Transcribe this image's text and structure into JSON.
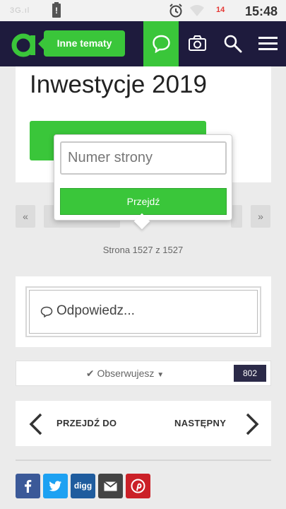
{
  "status_bar": {
    "signal_text": "3G.ıl",
    "battery_alert": "!",
    "badge": "14",
    "time": "15:48",
    "icons": [
      "signal-icon",
      "battery-icon",
      "alarm-icon",
      "wifi-icon"
    ]
  },
  "header": {
    "topics_label": "Inne tematy",
    "icons": [
      "logo-icon",
      "chat-icon",
      "camera-icon",
      "search-icon",
      "menu-icon"
    ],
    "colors": {
      "bar": "#1e1b3d",
      "accent": "#3ac63a"
    }
  },
  "main": {
    "title": "Inwestycje 2019",
    "pager": {
      "first": "«",
      "last": "»"
    },
    "page_info": "Strona 1527 z 1527"
  },
  "popup": {
    "input_placeholder": "Numer strony",
    "input_value": "",
    "go_label": "Przejdź"
  },
  "reply": {
    "label": "Odpowiedz..."
  },
  "follow": {
    "label": "Obserwujesz",
    "count": "802"
  },
  "navigation": {
    "prev_label": "PRZEJDŹ DO",
    "next_label": "NASTĘPNY"
  },
  "share": {
    "buttons": [
      {
        "name": "facebook",
        "color": "#3b5998"
      },
      {
        "name": "twitter",
        "color": "#1da1f2"
      },
      {
        "name": "digg",
        "label": "digg",
        "color": "#1f5c9e"
      },
      {
        "name": "email",
        "color": "#444444"
      },
      {
        "name": "pinterest",
        "color": "#cb2027"
      }
    ]
  }
}
